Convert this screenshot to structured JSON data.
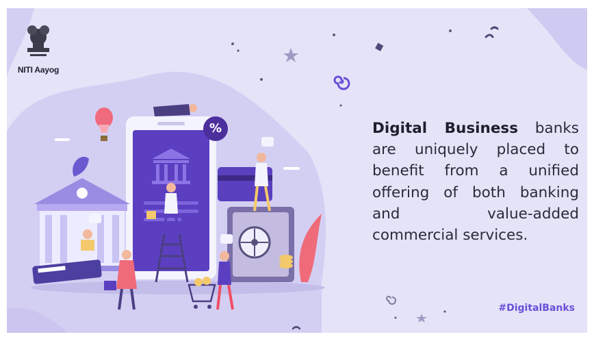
{
  "brand": {
    "logo_text": "NITI Aayog",
    "emblem_icon": "state-emblem-icon",
    "accent_color": "#6b4fd8",
    "background_color": "#e4e3f8"
  },
  "headline": {
    "bold_part": "Digital Business",
    "rest": " banks are uniquely placed to benefit from a unified offering of both banking and value-added commercial services."
  },
  "hashtag": "#DigitalBanks",
  "illustration": {
    "discount_badge": "%",
    "icons": [
      "smartphone-icon",
      "bank-building-icon",
      "vault-icon",
      "hot-air-balloon-icon",
      "shopping-cart-icon",
      "ladder-icon",
      "credit-card-icon",
      "atm-card-icon"
    ]
  }
}
